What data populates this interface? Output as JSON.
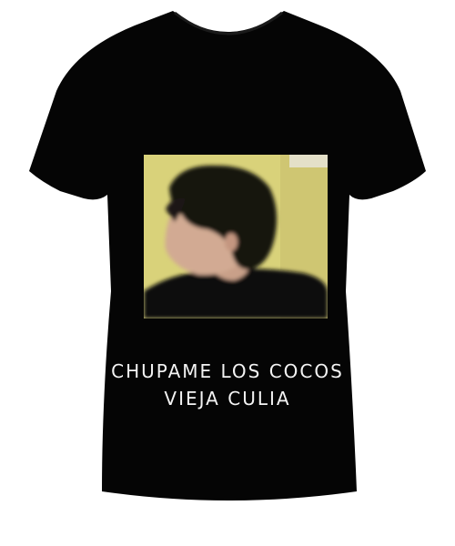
{
  "print": {
    "line1": "CHUPAME LOS COCOS",
    "line2": "VIEJA CULIA"
  },
  "colors": {
    "background": "#ffffff",
    "shirt": "#050505",
    "text": "#f4f4f4",
    "photo_wall": "#d9d27a"
  }
}
